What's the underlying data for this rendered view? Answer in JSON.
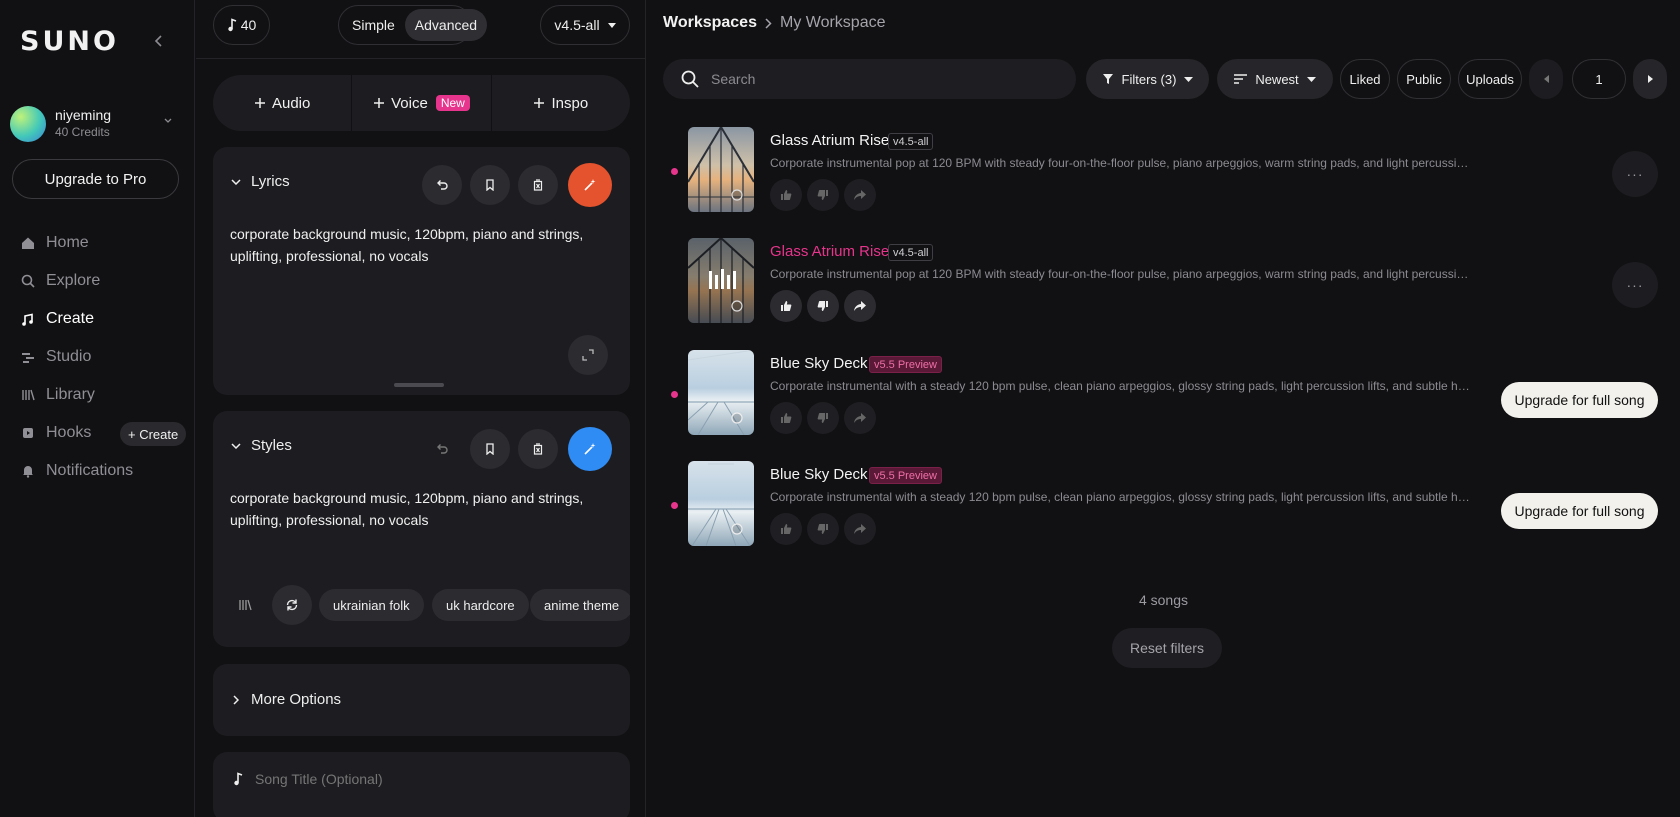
{
  "sidebar": {
    "logo": "SUNO",
    "user": {
      "name": "niyeming",
      "credits": "40 Credits"
    },
    "upgrade_label": "Upgrade to Pro",
    "nav": [
      {
        "label": "Home",
        "icon": "home-icon"
      },
      {
        "label": "Explore",
        "icon": "search-icon"
      },
      {
        "label": "Create",
        "icon": "create-music-icon",
        "active": true
      },
      {
        "label": "Studio",
        "icon": "studio-icon"
      },
      {
        "label": "Library",
        "icon": "library-icon"
      },
      {
        "label": "Hooks",
        "icon": "hooks-icon"
      },
      {
        "label": "Notifications",
        "icon": "bell-icon"
      }
    ],
    "hooks_create_label": "+ Create"
  },
  "create": {
    "credits": "40",
    "mode_simple": "Simple",
    "mode_advanced": "Advanced",
    "mode_selected": "Advanced",
    "model": "v4.5-all",
    "add_audio": "Audio",
    "add_voice": "Voice",
    "new_badge": "New",
    "add_inspo": "Inspo",
    "lyrics": {
      "label": "Lyrics",
      "text": "corporate background music, 120bpm, piano and strings, uplifting, professional, no vocals"
    },
    "styles": {
      "label": "Styles",
      "text": "corporate background music, 120bpm, piano and strings, uplifting, professional, no vocals",
      "tags": [
        "ukrainian folk",
        "uk hardcore",
        "anime theme"
      ]
    },
    "more_options": "More Options",
    "song_title_placeholder": "Song Title (Optional)"
  },
  "workspace": {
    "breadcrumb_root": "Workspaces",
    "breadcrumb_current": "My Workspace",
    "search_placeholder": "Search",
    "filters_label": "Filters (3)",
    "sort_label": "Newest",
    "liked_label": "Liked",
    "public_label": "Public",
    "uploads_label": "Uploads",
    "page": "1",
    "songs": [
      {
        "title": "Glass Atrium Rise",
        "version": "v4.5-all",
        "desc": "Corporate instrumental pop at 120 BPM with steady four-on-the-floor pulse, piano arpeggios, warm string pads, and light percussion accents",
        "playing": false,
        "preview": false,
        "unread": true
      },
      {
        "title": "Glass Atrium Rise",
        "version": "v4.5-all",
        "desc": "Corporate instrumental pop at 120 BPM with steady four-on-the-floor pulse, piano arpeggios, warm string pads, and light percussion accents",
        "playing": true,
        "preview": false,
        "unread": false
      },
      {
        "title": "Blue Sky Deck",
        "version": "v5.5 Preview",
        "desc": "Corporate instrumental with a steady 120 bpm pulse, clean piano arpeggios, glossy string pads, light percussion lifts, and subtle hand percussion",
        "playing": false,
        "preview": true,
        "unread": true,
        "upgrade": "Upgrade for full song"
      },
      {
        "title": "Blue Sky Deck",
        "version": "v5.5 Preview",
        "desc": "Corporate instrumental with a steady 120 bpm pulse, clean piano arpeggios, glossy string pads, light percussion lifts, and subtle hand percussion",
        "playing": false,
        "preview": true,
        "unread": true,
        "upgrade": "Upgrade for full song"
      }
    ],
    "songs_count": "4 songs",
    "reset_filters": "Reset filters"
  },
  "colors": {
    "accent_pink": "#e7348c",
    "accent_orange": "#e5532e",
    "accent_blue": "#2f8cf4",
    "background": "#111113",
    "card": "#1d1d21"
  }
}
